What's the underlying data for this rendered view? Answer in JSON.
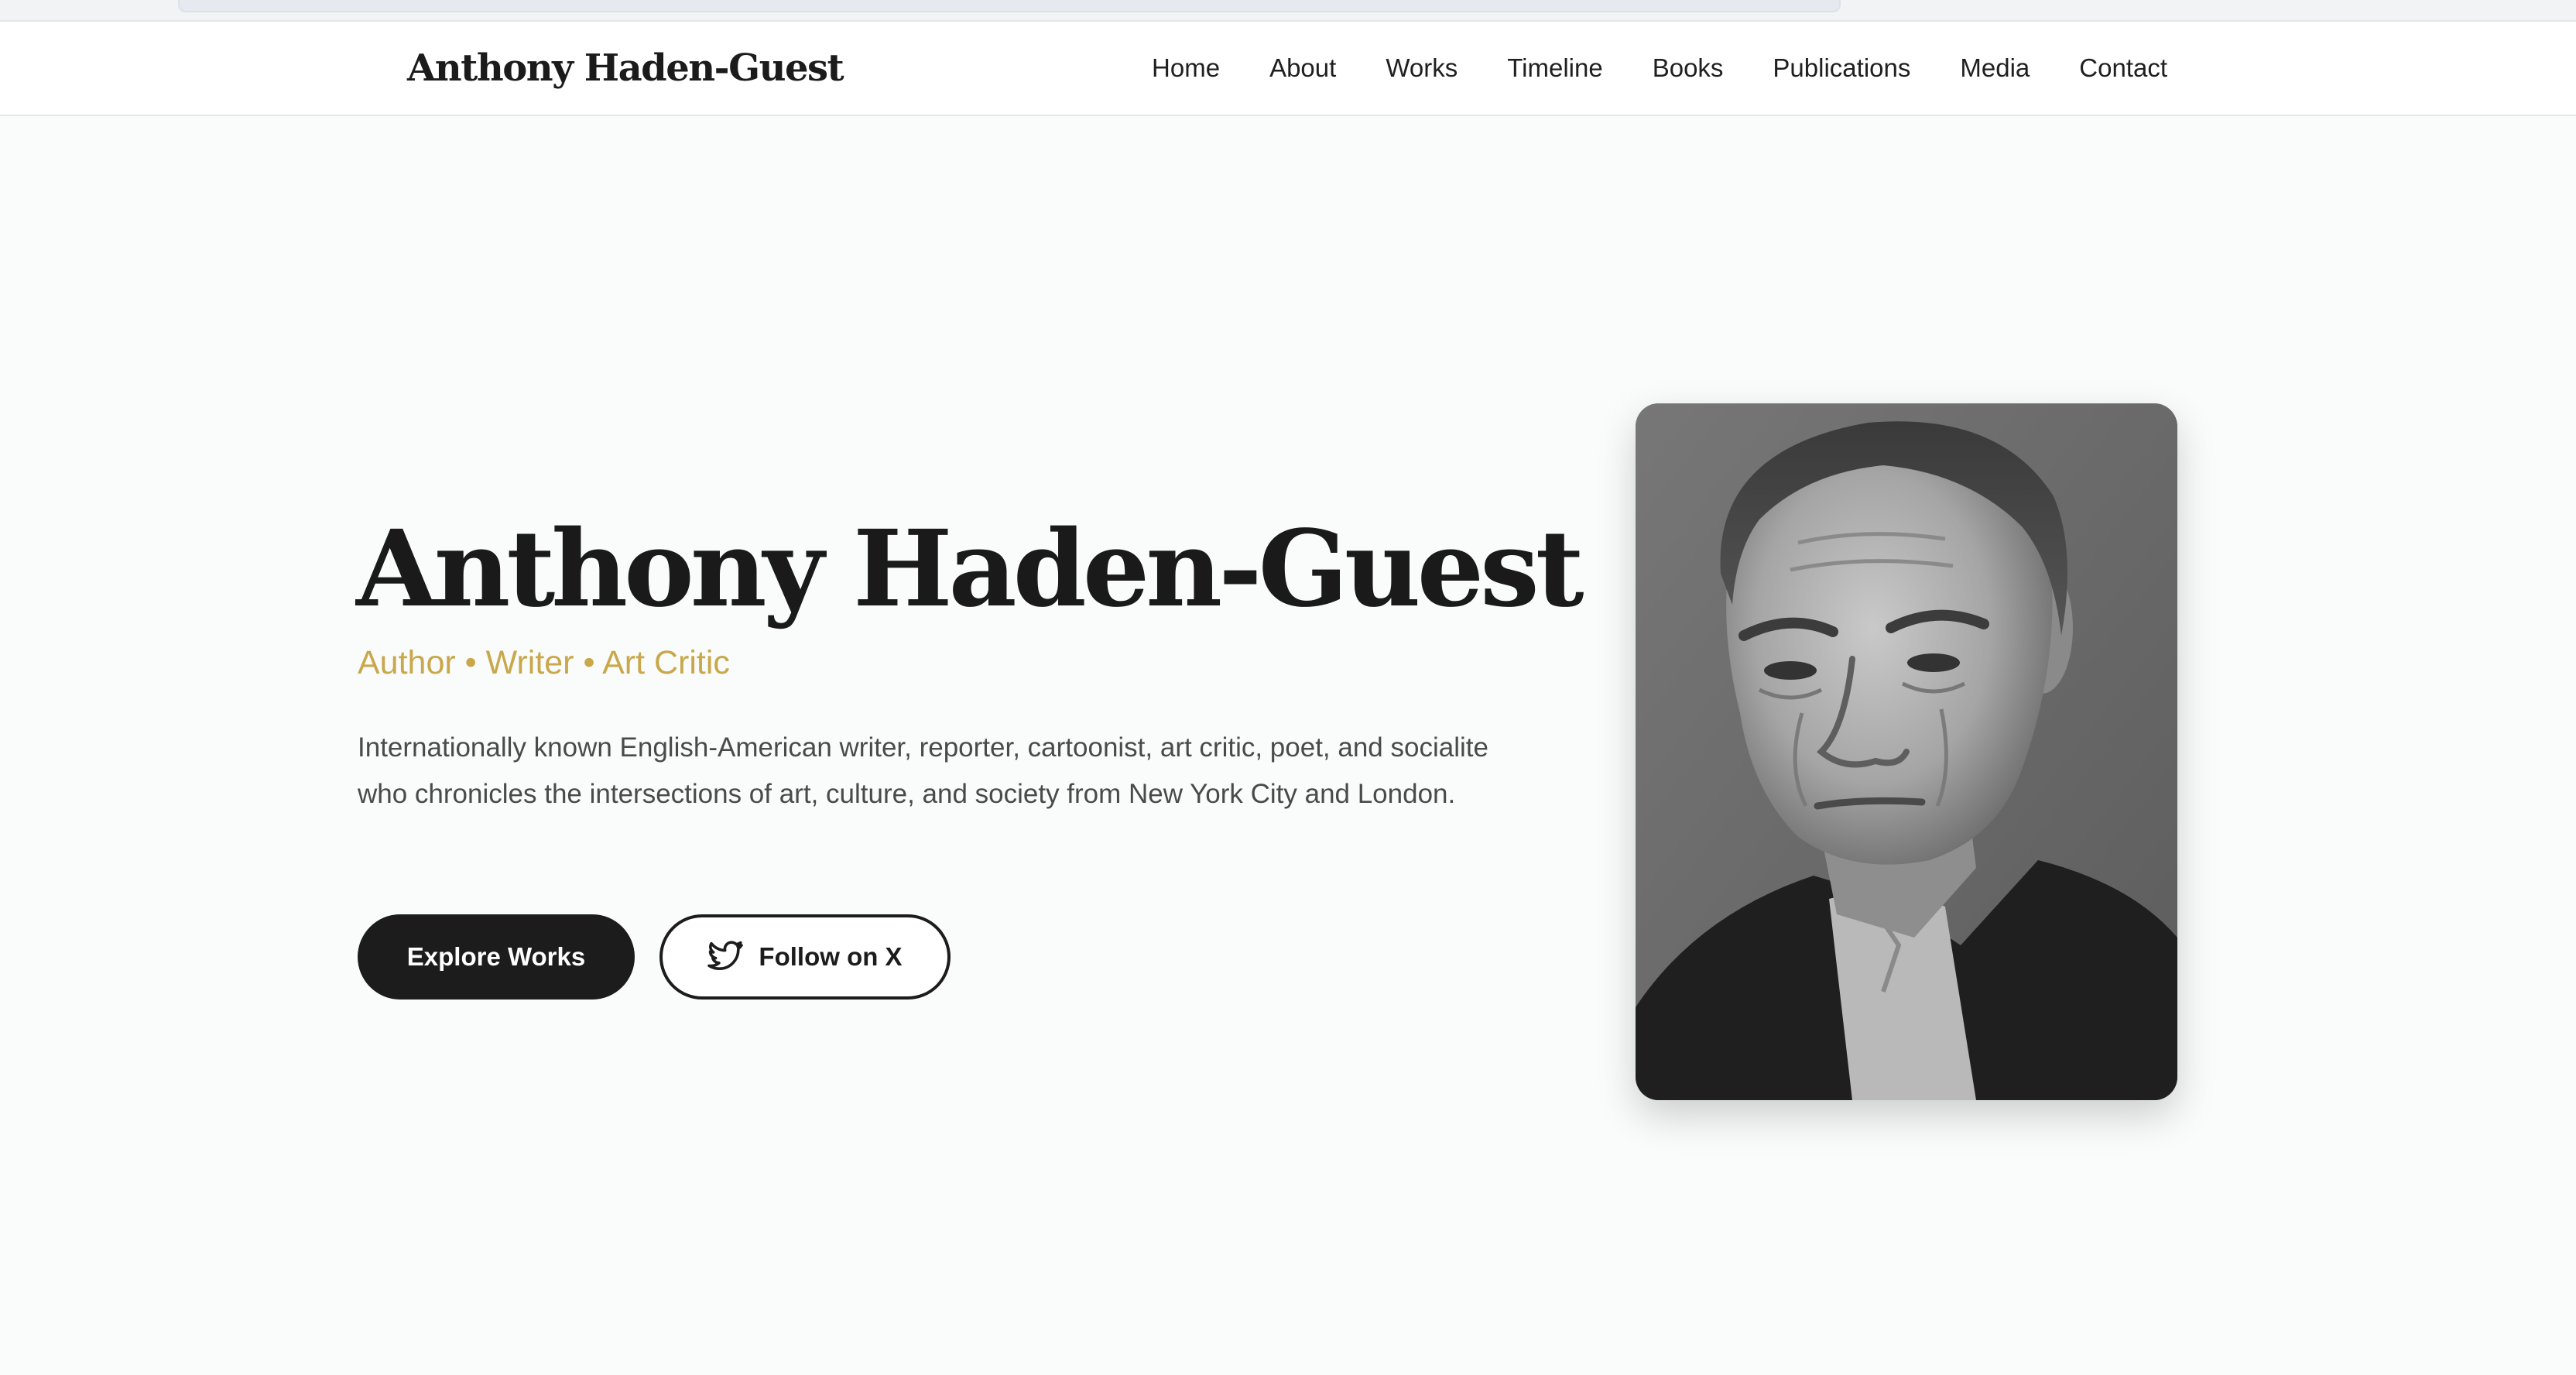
{
  "site": {
    "brand": "Anthony Haden-Guest"
  },
  "nav": {
    "items": [
      "Home",
      "About",
      "Works",
      "Timeline",
      "Books",
      "Publications",
      "Media",
      "Contact"
    ]
  },
  "hero": {
    "title": "Anthony Haden-Guest",
    "subtitle": "Author • Writer • Art Critic",
    "description": "Internationally known English-American writer, reporter, cartoonist, art critic, poet, and socialite who chronicles the intersections of art, culture, and society from New York City and London.",
    "primary_button": "Explore Works",
    "secondary_button": "Follow on X",
    "secondary_button_icon": "bird-icon",
    "portrait": "portrait-photo"
  },
  "colors": {
    "accent": "#c8a84a",
    "primary_button": "#1c1c1c",
    "background": "#fafbfb"
  }
}
